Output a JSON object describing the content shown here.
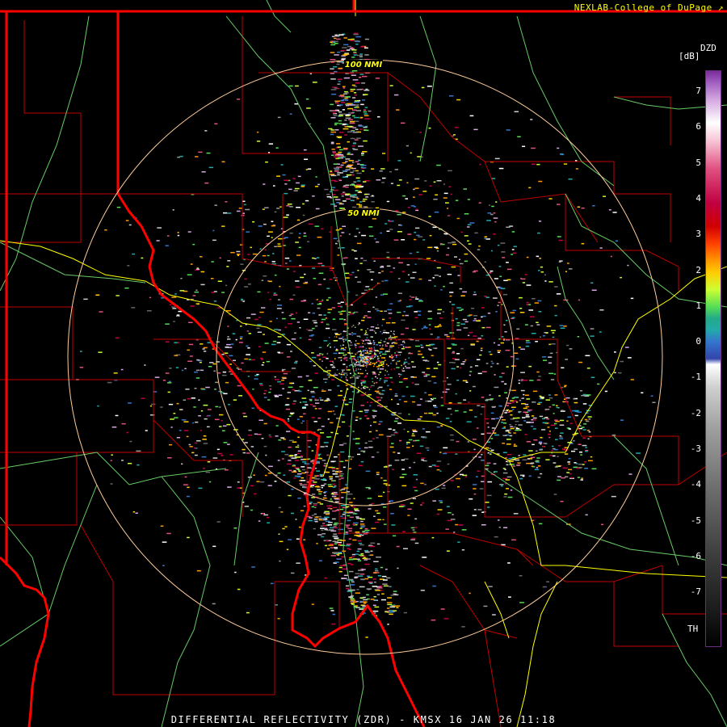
{
  "header": {
    "credit": "NEXLAB-College of DuPage",
    "credit_icon": "external-link-icon"
  },
  "footer": {
    "title": "DIFFERENTIAL REFLECTIVITY (ZDR) - KMSX 16 JAN 26 11:18"
  },
  "range_rings": [
    {
      "label": "100 NMI"
    },
    {
      "label": "50 NMI"
    }
  ],
  "legend": {
    "product": "DZD",
    "unit": "[dB]",
    "ticks": [
      "7",
      "6",
      "5",
      "4",
      "3",
      "2",
      "1",
      "0",
      "-1",
      "-2",
      "-3",
      "-4",
      "-5",
      "-6",
      "-7"
    ],
    "th_label": "TH",
    "colors": {
      "state_border": "#ff0000",
      "county_border": "#c00000",
      "highway": "#ffff00",
      "river": "#66cc66",
      "range_ring": "#ffcc99",
      "legend_frame": "#6a2c80"
    }
  }
}
